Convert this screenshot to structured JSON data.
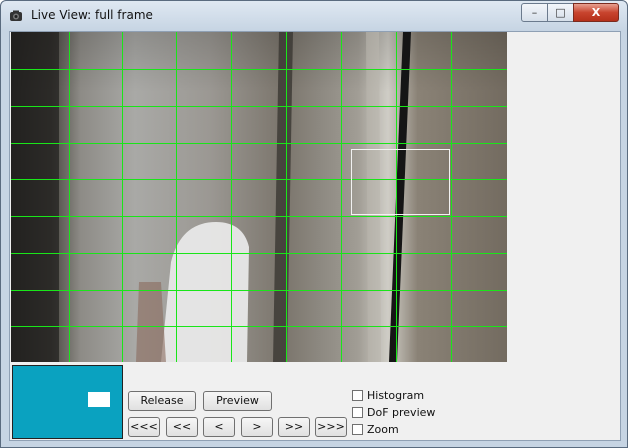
{
  "window": {
    "title": "Live View: full frame",
    "min_glyph": "–",
    "max_glyph": "□",
    "close_glyph": "X"
  },
  "controls": {
    "release_label": "Release",
    "preview_label": "Preview",
    "nav": [
      "<<<",
      "<<",
      "<",
      ">",
      ">>",
      ">>>"
    ]
  },
  "options": {
    "histogram_label": "Histogram",
    "histogram_checked": false,
    "dof_label": "DoF preview",
    "dof_checked": false,
    "zoom_label": "Zoom",
    "zoom_checked": false
  },
  "colors": {
    "grid": "#19e619",
    "thumbnail_bg": "#0aa2c0"
  }
}
